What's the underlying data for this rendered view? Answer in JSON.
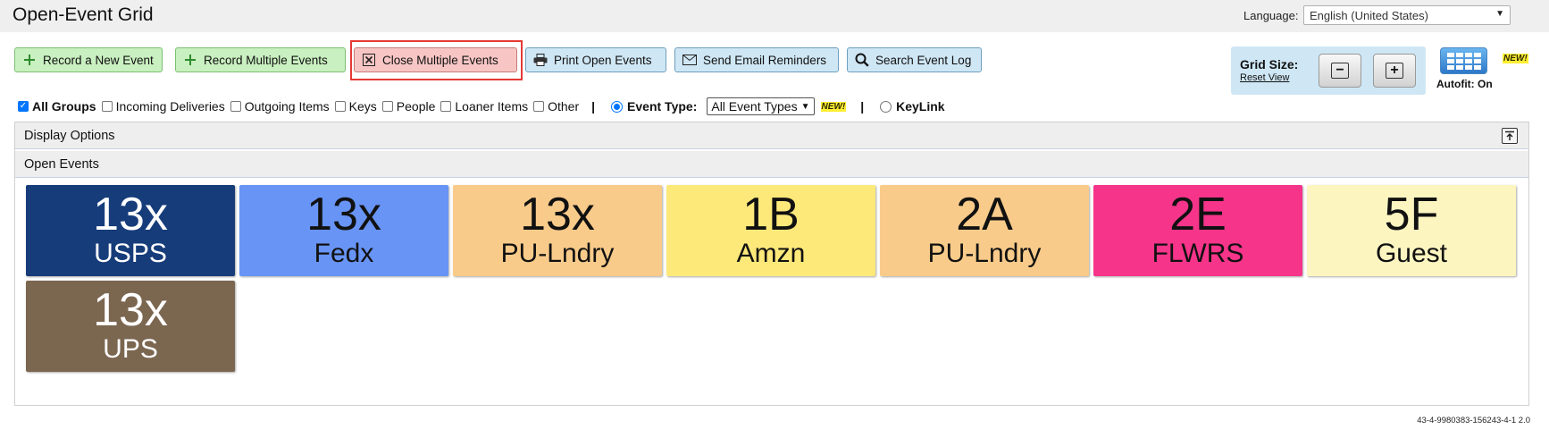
{
  "header": {
    "title": "Open-Event Grid",
    "language_label": "Language:",
    "language_value": "English (United States)"
  },
  "toolbar": {
    "record_new": "Record a New Event",
    "record_multiple": "Record Multiple Events",
    "close_multiple": "Close Multiple Events",
    "print_open": "Print Open Events",
    "send_reminders": "Send Email Reminders",
    "search_log": "Search Event Log"
  },
  "grid_size": {
    "label": "Grid Size:",
    "reset": "Reset View",
    "decrease": "−",
    "increase": "+",
    "autofit_label": "Autofit: On",
    "new_badge": "NEW!"
  },
  "filters": {
    "groups": [
      {
        "label": "All Groups",
        "checked": true
      },
      {
        "label": "Incoming Deliveries",
        "checked": false
      },
      {
        "label": "Outgoing Items",
        "checked": false
      },
      {
        "label": "Keys",
        "checked": false
      },
      {
        "label": "People",
        "checked": false
      },
      {
        "label": "Loaner Items",
        "checked": false
      },
      {
        "label": "Other",
        "checked": false
      }
    ],
    "separator": "|",
    "event_type_label": "Event Type:",
    "event_type_value": "All Event Types",
    "new_badge": "NEW!",
    "keylink_label": "KeyLink"
  },
  "panels": {
    "display_options": "Display Options",
    "open_events": "Open Events"
  },
  "tiles": [
    {
      "top": "13x",
      "bottom": "USPS",
      "bg": "#163c7a",
      "fg": "#ffffff"
    },
    {
      "top": "13x",
      "bottom": "Fedx",
      "bg": "#6894f5",
      "fg": "#111111"
    },
    {
      "top": "13x",
      "bottom": "PU-Lndry",
      "bg": "#f9cb8a",
      "fg": "#111111"
    },
    {
      "top": "1B",
      "bottom": "Amzn",
      "bg": "#fde97a",
      "fg": "#111111"
    },
    {
      "top": "2A",
      "bottom": "PU-Lndry",
      "bg": "#f9cb8a",
      "fg": "#111111"
    },
    {
      "top": "2E",
      "bottom": "FLWRS",
      "bg": "#f5348a",
      "fg": "#111111"
    },
    {
      "top": "5F",
      "bottom": "Guest",
      "bg": "#fdf5c0",
      "fg": "#111111"
    },
    {
      "top": "13x",
      "bottom": "UPS",
      "bg": "#7b6650",
      "fg": "#ffffff"
    }
  ],
  "footer": {
    "version": "43-4-9980383-156243-4-1 2.0"
  }
}
